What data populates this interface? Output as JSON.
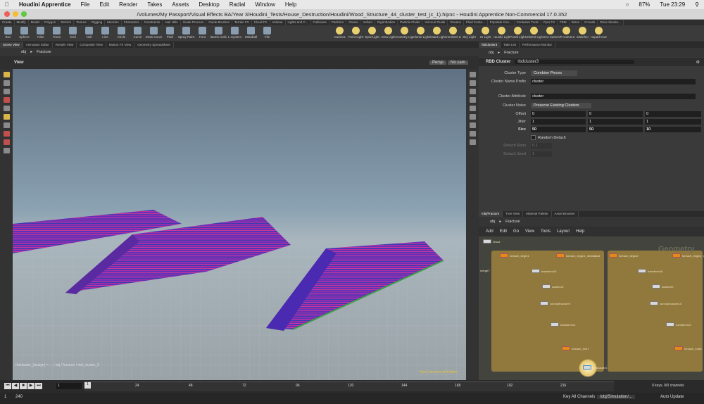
{
  "menubar": {
    "app_name": "Houdini Apprentice",
    "items": [
      "File",
      "Edit",
      "Render",
      "Takes",
      "Assets",
      "Desktop",
      "Radial",
      "Window",
      "Help"
    ],
    "battery": "87%",
    "clock": "Tue 23:29"
  },
  "window": {
    "title": "/Volumes/My Passport/Visual Effects BA/Year 3/Houdini_Tests/House_Destruction/Houdini/Wood_Structure_44_cluster_test_jc_1).hipnc - Houdini Apprentice Non-Commercial 17.0.352"
  },
  "shelf": {
    "tabs": [
      "Create",
      "Modify",
      "Model",
      "Polygon",
      "Deform",
      "Texture",
      "Rigging",
      "Muscles",
      "Characters",
      "Constraints",
      "Hair Utils",
      "Guide Process",
      "Guide Brushes",
      "Terrain FX",
      "Cloud FX",
      "Volume",
      "Lights and C...",
      "Collisions",
      "Particles",
      "Grains",
      "Vellum",
      "Rigid Bodies",
      "Particle Fluids",
      "Viscous Fluids",
      "Oceans",
      "Fluid Conta...",
      "Populate Con...",
      "Container Tools",
      "Pyro FX",
      "FEM",
      "Wires",
      "Crowds",
      "Drive Simula..."
    ],
    "tools": [
      "Box",
      "Sphere",
      "Tube",
      "Torus",
      "Grid",
      "Null",
      "Line",
      "Circle",
      "Curve",
      "Draw Curve",
      "Path",
      "Spray Paint",
      "Font",
      "Platonic Solids",
      "L-System",
      "Metaball",
      "File"
    ],
    "light_tools": [
      "Camera",
      "Point Light",
      "Spot Light",
      "Area Light",
      "Geometry Light",
      "Volume Light",
      "Distant Light",
      "Environment Light",
      "Sky Light",
      "GI Light",
      "Caustic Light",
      "Portal Light",
      "Ambient Light",
      "Stereo Camera",
      "VR Camera",
      "Switcher",
      "Gamepad Camera"
    ]
  },
  "left_pane": {
    "tabs": [
      "Scene View",
      "Animation Editor",
      "Render View",
      "Composite View",
      "Motion FX View",
      "Geometry Spreadsheet"
    ],
    "path": [
      "obj",
      "Fracture"
    ],
    "view_label": "View",
    "persp_label": "Persp",
    "cam_label": "No cam",
    "viewport_status": "Non-Commercial Edition",
    "bottom_readout": "rbdcluster_{assign} = ... / obj / fracture / rbd_cluster_3"
  },
  "right_pane": {
    "tabs": [
      "rbdcluster3",
      "Take List",
      "Performance Monitor"
    ],
    "path": [
      "obj",
      "Fracture"
    ],
    "node_type": "RBD Cluster",
    "node_name": "rbdcluster3",
    "params": {
      "cluster_type_label": "Cluster Type",
      "cluster_type_value": "Combine Pieces",
      "prefix_label": "Cluster Name Prefix",
      "prefix_value": "cluster",
      "attribute_label": "Cluster Attribute",
      "attribute_value": "cluster",
      "noise_label": "Cluster Noise",
      "noise_value": "Preserve Existing Clusters",
      "offset_label": "Offset",
      "offset_values": [
        "0",
        "0",
        "0"
      ],
      "jitter_label": "Jitter",
      "jitter_values": [
        "1",
        "1",
        "1"
      ],
      "size_label": "Size",
      "size_values": [
        "50",
        "50",
        "10"
      ],
      "random_detach_label": "Random Detach",
      "detach_ratio_label": "Detach Ratio",
      "detach_ratio_value": "0.1",
      "detach_seed_label": "Detach Seed",
      "detach_seed_value": "1"
    }
  },
  "network_pane": {
    "tabs": [
      "/obj/Fracture",
      "Tree View",
      "Material Palette",
      "Asset Browser"
    ],
    "path": [
      "obj",
      "Fracture"
    ],
    "menu": [
      "Add",
      "Edit",
      "Go",
      "View",
      "Tools",
      "Layout",
      "Help"
    ],
    "context_label": "Geometry",
    "nodes": {
      "file": "Wood",
      "fetch_left": "foreach_begin1",
      "fetch_left_sub": "foreach_begin1_metadata1",
      "fetch_right": "foreach_begin2",
      "fetch_right_sub": "foreach_begin2_metadata1",
      "xform_left": "transform15",
      "xform_right": "transform16",
      "sub_left": "scatter19",
      "sub_right": "scatter20",
      "vor_left": "voronoifracture9",
      "vor_right": "voronoifracture10",
      "x2_left": "transform14",
      "x2_right": "transform13",
      "end_left": "foreach_end7",
      "end_right": "foreach_end8",
      "cluster": "rbdcluster3",
      "side": "merge7"
    }
  },
  "timeline": {
    "current_frame": "1",
    "ticks": [
      "1",
      "24",
      "48",
      "72",
      "96",
      "120",
      "144",
      "168",
      "192",
      "216",
      "240"
    ],
    "start": "1",
    "end": "240",
    "keys_label": "0 keys, 0/0 channels",
    "key_all": "Key All Channels"
  },
  "status": {
    "sim_path": "/obj/Simulation/...",
    "update_mode": "Auto Update"
  }
}
